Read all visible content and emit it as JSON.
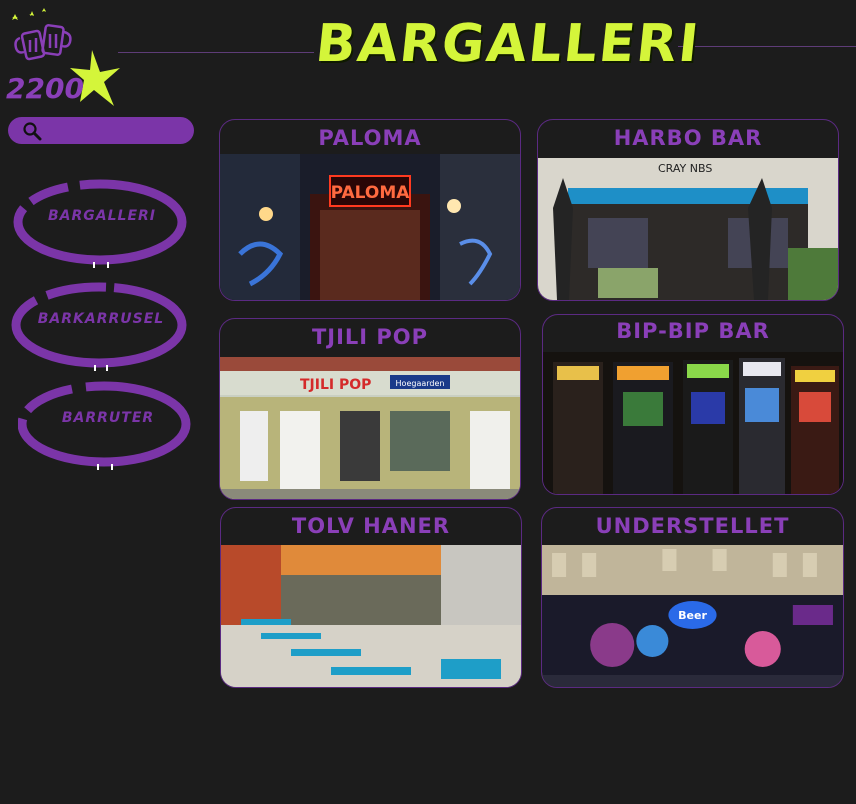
{
  "brand": {
    "logo_text": "2200"
  },
  "header": {
    "title": "BARGALLERI"
  },
  "search": {
    "placeholder": "",
    "value": ""
  },
  "nav": {
    "items": [
      {
        "label": "BARGALLERI"
      },
      {
        "label": "BARKARRUSEL"
      },
      {
        "label": "BARRUTER"
      }
    ]
  },
  "bars": [
    {
      "name": "PALOMA",
      "sign": "PALOMA"
    },
    {
      "name": "HARBO BAR",
      "sign": "CRAY NBS"
    },
    {
      "name": "TJILI POP",
      "sign": "TJILI POP",
      "sign2": "Hoegaarden"
    },
    {
      "name": "BIP-BIP BAR"
    },
    {
      "name": "TOLV HANER"
    },
    {
      "name": "UNDERSTELLET",
      "sign": "Beer"
    }
  ],
  "colors": {
    "background": "#1c1c1c",
    "accent_purple": "#7b35a8",
    "title_green": "#d4f53a"
  }
}
